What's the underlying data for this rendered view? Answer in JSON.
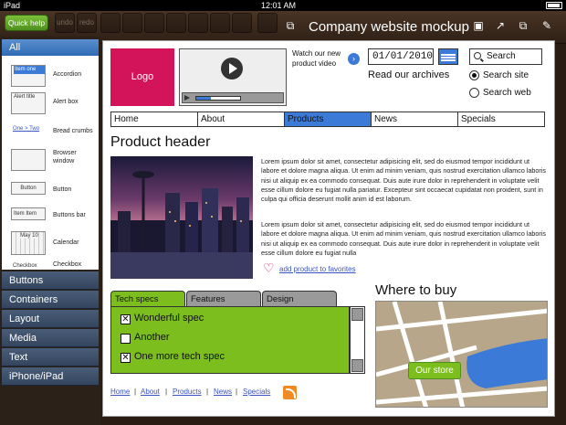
{
  "status": {
    "carrier": "iPad",
    "time": "12:01 AM"
  },
  "toolbar": {
    "quick_help": "Quick help",
    "undo": "undo",
    "redo": "redo",
    "doc_title": "Company website mockup"
  },
  "library": {
    "all_label": "All",
    "items": [
      {
        "thumb": "Item one",
        "name": "Accordion"
      },
      {
        "thumb": "Alert title",
        "name": "Alert box"
      },
      {
        "thumb": "One > Two",
        "name": "Bread crumbs"
      },
      {
        "thumb": "",
        "name": "Browser window"
      },
      {
        "thumb": "Button",
        "name": "Button"
      },
      {
        "thumb": "Item  Item",
        "name": "Buttons bar"
      },
      {
        "thumb": "May 10",
        "name": "Calendar"
      },
      {
        "thumb": "Checkbox",
        "name": "Checkbox"
      }
    ],
    "categories": [
      "Buttons",
      "Containers",
      "Layout",
      "Media",
      "Text",
      "iPhone/iPad"
    ]
  },
  "mockup": {
    "logo": "Logo",
    "video_caption": "Watch our new product video",
    "date": "01/01/2010",
    "archives": "Read our archives",
    "search_placeholder": "Search",
    "radio_site": "Search site",
    "radio_web": "Search web",
    "nav": [
      "Home",
      "About",
      "Products",
      "News",
      "Specials"
    ],
    "nav_active": "Products",
    "product_header": "Product header",
    "para1": "Lorem ipsum dolor sit amet, consectetur adipisicing elit, sed do eiusmod tempor incididunt ut labore et dolore magna aliqua. Ut enim ad minim veniam, quis nostrud exercitation ullamco laboris nisi ut aliquip ex ea commodo consequat. Duis aute irure dolor in reprehenderit in voluptate velit esse cillum dolore eu fugiat nulla pariatur. Excepteur sint occaecat cupidatat non proident, sunt in culpa qui officia deserunt mollit anim id est laborum.",
    "para2": "Lorem ipsum dolor sit amet, consectetur adipisicing elit, sed do eiusmod tempor incididunt ut labore et dolore magna aliqua. Ut enim ad minim veniam, quis nostrud exercitation ullamco laboris nisi ut aliquip ex ea commodo consequat. Duis aute irure dolor in reprehenderit in voluptate velit esse cillum dolore eu fugiat nulla",
    "favorites": "add product to favorites",
    "tabs": [
      "Tech specs",
      "Features",
      "Design"
    ],
    "specs": [
      {
        "label": "Wonderful spec",
        "checked": true
      },
      {
        "label": "Another",
        "checked": false
      },
      {
        "label": "One more tech spec",
        "checked": true
      }
    ],
    "where_title": "Where to buy",
    "store": "Our store",
    "footer": [
      "Home",
      "About",
      "Products",
      "News",
      "Specials"
    ]
  },
  "colors": {
    "accent_blue": "#3b7ad6",
    "green": "#7cbe1e",
    "logo_pink": "#d4145a"
  }
}
